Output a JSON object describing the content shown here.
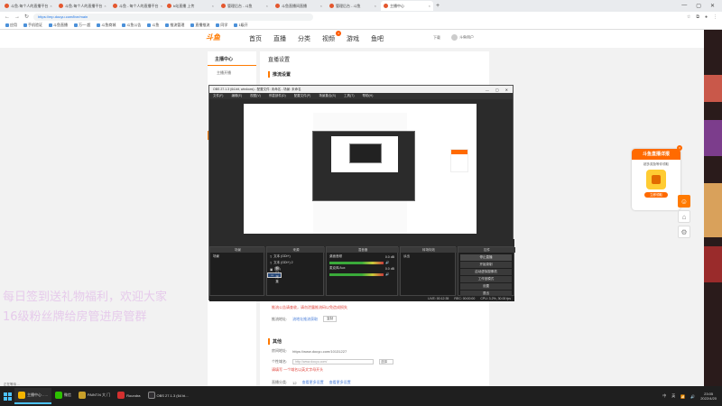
{
  "browser": {
    "tabs": [
      {
        "label": "斗鱼-每个人的直播平台",
        "active": false
      },
      {
        "label": "斗鱼-每个人的直播平台",
        "active": false
      },
      {
        "label": "斗鱼 - 每个人的直播平台",
        "active": false
      },
      {
        "label": "b站直播 上传",
        "active": false
      },
      {
        "label": "管理后台 - 斗鱼",
        "active": false
      },
      {
        "label": "斗鱼直播间直播",
        "active": false
      },
      {
        "label": "管理后台 - 斗鱼",
        "active": false
      },
      {
        "label": "主播中心",
        "active": true
      }
    ],
    "url": "https://mp.douyu.com/live/main",
    "bookmarks": [
      "应用",
      "手机验证",
      "斗鱼直播",
      "万一·超",
      "斗鱼商城",
      "斗鱼公告",
      "斗鱼",
      "推流管理",
      "直播推流",
      "同学",
      "1级开"
    ]
  },
  "site": {
    "logo": "斗鱼",
    "nav": [
      "首页",
      "直播",
      "分类",
      "视频",
      "游戏",
      "鱼吧"
    ],
    "nav_badge": "3",
    "header_right": [
      "下载",
      "斗鱼用户"
    ]
  },
  "sidebar": {
    "title": "主播中心",
    "item": "主播开播"
  },
  "main": {
    "title": "直播设置",
    "section1": "推流设置",
    "notice": "推流公告请查收，请勿泄露推流码以免造成损失",
    "row_label": "推流地址:",
    "row_value": "流地址推流获取",
    "row_btn": "复制",
    "section2": "其他",
    "room_label": "房间地址:",
    "room_value": "https://www.douyu.com/10131227",
    "domain_label": "个性域名:",
    "domain_placeholder": "http://www.douyu.com/",
    "domain_select": "选择",
    "domain_hint": "请填写 一个域名以英文字母开头",
    "count_label": "直播分类:",
    "count_value": "12",
    "link1": "查看更多设置",
    "link2": "查看更多设置"
  },
  "overlay": {
    "line1": "每日签到送礼物福利，欢迎大家",
    "line2": "16级粉丝牌给房管进房管群"
  },
  "promo": {
    "title": "斗鱼直播详报",
    "sub": "超多奖励等你领取",
    "btn": "立即领取",
    "close": "×"
  },
  "obs": {
    "title": "OBS 27.1.3 (64-bit, windows) - 配置文件: 未命名 - 场景: 未命名",
    "menu": [
      "文件(F)",
      "编辑(E)",
      "视图(V)",
      "停靠部件(D)",
      "配置文件(P)",
      "场景集合(S)",
      "工具(T)",
      "帮助(H)"
    ],
    "docks": {
      "scenes": "场景",
      "sources": "来源",
      "mixer": "混音器",
      "transitions": "转场特效",
      "controls": "控件"
    },
    "scene_item": "场景",
    "source_items": [
      "文本 (GDI+)",
      "文本 (GDI+) 2",
      "图片",
      "窗口采集"
    ],
    "mixer_items": [
      {
        "name": "桌面音频",
        "db": "0.0 dB"
      },
      {
        "name": "麦克风/Aux",
        "db": "0.0 dB"
      }
    ],
    "transition": "淡出",
    "controls": [
      "停止直播",
      "开始录制",
      "启动虚拟摄像机",
      "工作室模式",
      "设置",
      "退出"
    ],
    "status": [
      "LIVE: 00:12:35",
      "REC: 00:00:00",
      "CPU: 3.2%, 30.00 fps"
    ],
    "label_scene": "场景"
  },
  "taskbar": {
    "items": [
      "主播中心 - ...",
      "微信",
      "PAINT.N 大 门",
      "Roundra",
      "OBS 27.1.3 (64 bi..."
    ],
    "tray": [
      "中",
      "英"
    ],
    "time": "23:05",
    "date": "2022/4/20"
  },
  "statusbar": "正在等待 ..."
}
